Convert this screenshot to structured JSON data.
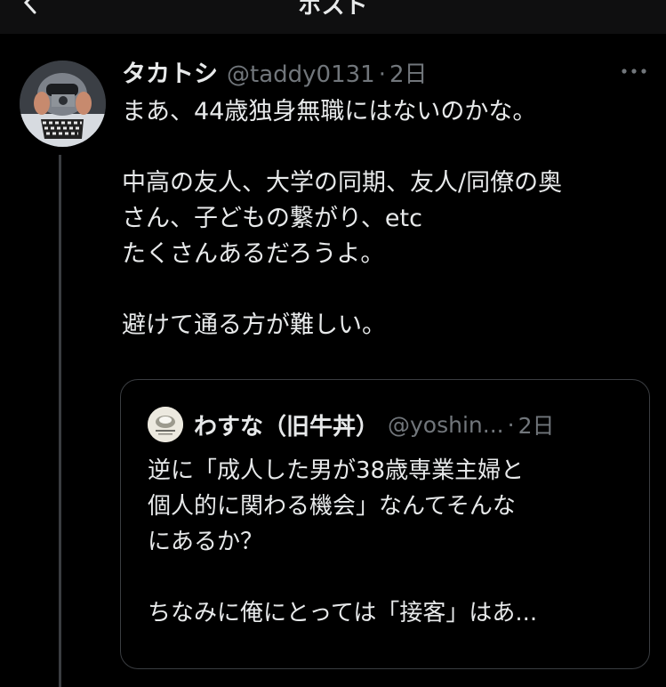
{
  "header": {
    "title": "ポスト"
  },
  "icons": {
    "back": "chevron-left-icon",
    "more": "more-horizontal-icon",
    "avatar": "user-photo-avatar",
    "quote_avatar": "lotus-avatar"
  },
  "tweet": {
    "display_name": "タカトシ",
    "handle": "@taddy0131",
    "separator": "·",
    "time": "2日",
    "lines": [
      "まあ、44歳独身無職にはないのかな。",
      "",
      "中高の友人、大学の同期、友人/同僚の奥",
      "さん、子どもの繋がり、etc",
      "たくさんあるだろうよ。",
      "",
      "避けて通る方が難しい。"
    ]
  },
  "quote": {
    "display_name": "わすな（旧牛丼）",
    "handle": "@yoshin...",
    "separator": "·",
    "time": "2日",
    "lines": [
      "逆に「成人した男が38歳専業主婦と",
      "個人的に関わる機会」なんてそんな",
      "にあるか？",
      "",
      "ちなみに俺にとっては「接客」はあ..."
    ]
  },
  "colors": {
    "background": "#000000",
    "text": "#e7e9ea",
    "secondary": "#71767b",
    "border": "#3a3d41"
  }
}
